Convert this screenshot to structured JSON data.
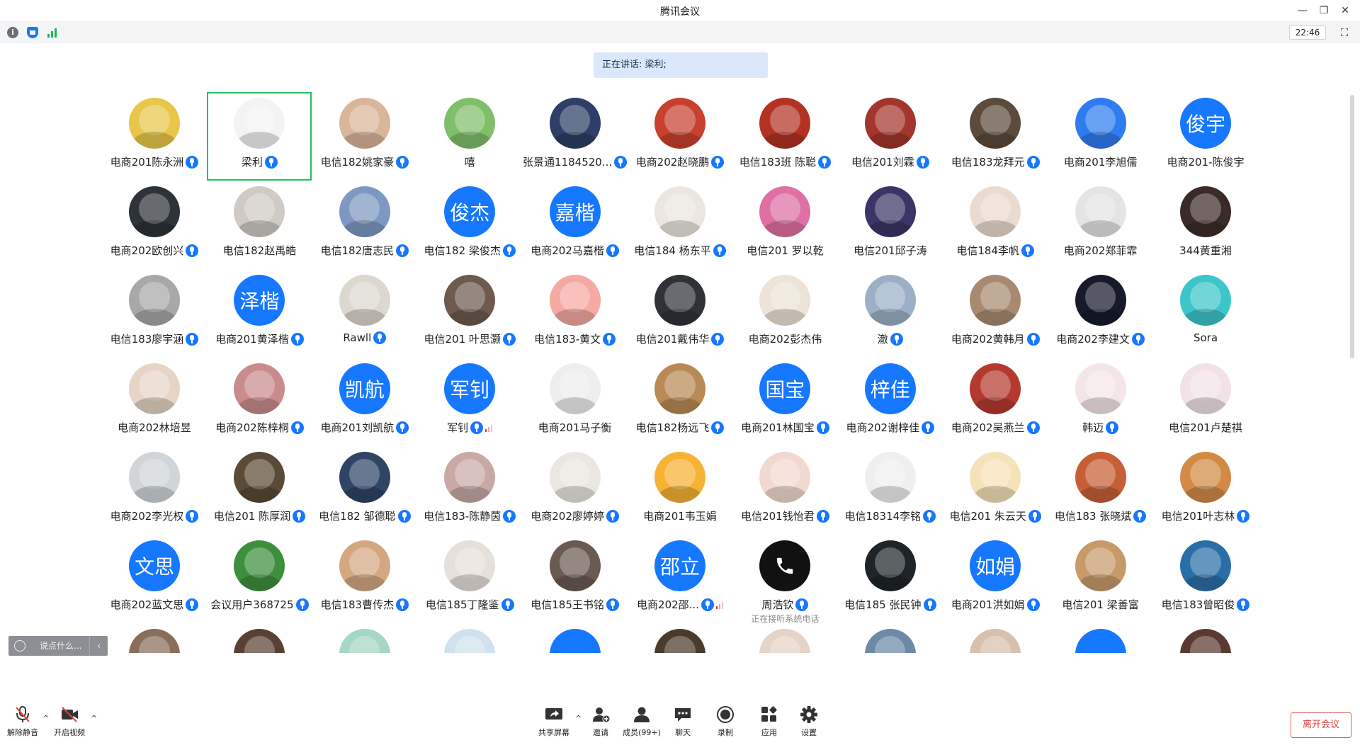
{
  "window": {
    "title": "腾讯会议",
    "minimize": "—",
    "restore": "❐",
    "close": "✕"
  },
  "status": {
    "info_icon": "i",
    "clock": "22:46",
    "fullscreen": "⛶"
  },
  "speaker": "正在讲话: 梁利;",
  "participants": [
    {
      "name": "电商201陈永洲",
      "mic": true,
      "color": "#e8c64a",
      "type": "photo"
    },
    {
      "name": "梁利",
      "mic": true,
      "color": "#f3f3f3",
      "type": "photo",
      "active": true
    },
    {
      "name": "电信182姚家豪",
      "mic": true,
      "color": "#d9b59a",
      "type": "photo"
    },
    {
      "name": "嘻",
      "mic": false,
      "color": "#7fbf6a",
      "type": "photo"
    },
    {
      "name": "张景通1184520...",
      "mic": true,
      "color": "#2d3f66",
      "type": "photo"
    },
    {
      "name": "电商202赵晓鹏",
      "mic": true,
      "color": "#c8412e",
      "type": "photo"
    },
    {
      "name": "电信183班 陈聪",
      "mic": true,
      "color": "#b33323",
      "type": "photo"
    },
    {
      "name": "电信201刘霖",
      "mic": true,
      "color": "#a3352c",
      "type": "photo"
    },
    {
      "name": "电信183龙拜元",
      "mic": true,
      "color": "#5c4a3a",
      "type": "photo"
    },
    {
      "name": "电商201李旭儒",
      "mic": false,
      "color": "#2f7cf0",
      "type": "photo"
    },
    {
      "name": "电商201-陈俊宇",
      "mic": false,
      "color": "#1677ff",
      "type": "text",
      "initials": "俊宇"
    },
    {
      "name": "电商202欧创兴",
      "mic": true,
      "color": "#2d3338",
      "type": "photo"
    },
    {
      "name": "电信182赵禹皓",
      "mic": false,
      "color": "#cfcac4",
      "type": "photo"
    },
    {
      "name": "电信182唐志民",
      "mic": true,
      "color": "#7d99c2",
      "type": "photo"
    },
    {
      "name": "电信182 梁俊杰",
      "mic": true,
      "color": "#1677ff",
      "type": "text",
      "initials": "俊杰"
    },
    {
      "name": "电商202马嘉楷",
      "mic": true,
      "color": "#1677ff",
      "type": "text",
      "initials": "嘉楷"
    },
    {
      "name": "电信184 杨东平",
      "mic": true,
      "color": "#ebe7e0",
      "type": "photo"
    },
    {
      "name": "电信201  罗以乾",
      "mic": false,
      "color": "#e06fa3",
      "type": "photo"
    },
    {
      "name": "电信201邱子涛",
      "mic": false,
      "color": "#3a3566",
      "type": "photo"
    },
    {
      "name": "电信184李帆",
      "mic": true,
      "color": "#eadbd0",
      "type": "photo"
    },
    {
      "name": "电商202郑菲霏",
      "mic": false,
      "color": "#e4e4e4",
      "type": "photo"
    },
    {
      "name": "344黄重湘",
      "mic": false,
      "color": "#3b2b28",
      "type": "photo"
    },
    {
      "name": "电信183廖宇涵",
      "mic": true,
      "color": "#a8a8a8",
      "type": "photo"
    },
    {
      "name": "电商201黄泽楷",
      "mic": true,
      "color": "#1677ff",
      "type": "text",
      "initials": "泽楷"
    },
    {
      "name": "Rawll",
      "mic": true,
      "color": "#ddd8cf",
      "type": "photo"
    },
    {
      "name": "电信201 叶思灏",
      "mic": true,
      "color": "#6e5a4f",
      "type": "photo"
    },
    {
      "name": "电信183-黄文",
      "mic": true,
      "color": "#f4a9a3",
      "type": "photo"
    },
    {
      "name": "电信201戴伟华",
      "mic": true,
      "color": "#2f3338",
      "type": "photo"
    },
    {
      "name": "电商202彭杰伟",
      "mic": false,
      "color": "#ede3d6",
      "type": "photo"
    },
    {
      "name": "澈",
      "mic": true,
      "color": "#9bb0c6",
      "type": "photo"
    },
    {
      "name": "电商202黄韩月",
      "mic": true,
      "color": "#a88a71",
      "type": "photo"
    },
    {
      "name": "电商202李建文",
      "mic": true,
      "color": "#161a2a",
      "type": "photo"
    },
    {
      "name": "Sora",
      "mic": false,
      "color": "#3cc6c9",
      "type": "photo"
    },
    {
      "name": "电商202林培昱",
      "mic": false,
      "color": "#e6d4c5",
      "type": "photo"
    },
    {
      "name": "电商202陈梓桐",
      "mic": true,
      "color": "#c98b8c",
      "type": "photo"
    },
    {
      "name": "电商201刘凯航",
      "mic": true,
      "color": "#1677ff",
      "type": "text",
      "initials": "凯航"
    },
    {
      "name": "军钊",
      "mic": true,
      "vol": true,
      "color": "#1677ff",
      "type": "text",
      "initials": "军钊"
    },
    {
      "name": "电商201马子衡",
      "mic": false,
      "color": "#eeeeee",
      "type": "photo"
    },
    {
      "name": "电信182杨远飞",
      "mic": true,
      "color": "#b98a55",
      "type": "photo"
    },
    {
      "name": "电商201林国宝",
      "mic": true,
      "color": "#1677ff",
      "type": "text",
      "initials": "国宝"
    },
    {
      "name": "电商202谢梓佳",
      "mic": true,
      "color": "#1677ff",
      "type": "text",
      "initials": "梓佳"
    },
    {
      "name": "电商202吴燕兰",
      "mic": true,
      "color": "#b43a2f",
      "type": "photo"
    },
    {
      "name": "韩迈",
      "mic": true,
      "color": "#f4e6e6",
      "type": "photo"
    },
    {
      "name": "电信201卢楚祺",
      "mic": false,
      "color": "#f2e2e8",
      "type": "photo"
    },
    {
      "name": "电商202李光权",
      "mic": true,
      "color": "#cfd5d8",
      "type": "photo"
    },
    {
      "name": "电信201 陈厚润",
      "mic": true,
      "color": "#5b4a35",
      "type": "photo"
    },
    {
      "name": "电信182 邹德聪",
      "mic": true,
      "color": "#2e4566",
      "type": "photo"
    },
    {
      "name": "电信183-陈静茵",
      "mic": true,
      "color": "#c9a9a5",
      "type": "photo"
    },
    {
      "name": "电商202廖婷婷",
      "mic": true,
      "color": "#eae7e1",
      "type": "photo"
    },
    {
      "name": "电商201韦玉娟",
      "mic": false,
      "color": "#f6b233",
      "type": "photo"
    },
    {
      "name": "电信201钱怡君",
      "mic": true,
      "color": "#f1d9cf",
      "type": "photo"
    },
    {
      "name": "电信18314李铭",
      "mic": true,
      "color": "#efefef",
      "type": "photo"
    },
    {
      "name": "电信201 朱云天",
      "mic": true,
      "color": "#f5e2b8",
      "type": "photo"
    },
    {
      "name": "电信183 张晓斌",
      "mic": true,
      "color": "#c65e36",
      "type": "photo"
    },
    {
      "name": "电信201叶志林",
      "mic": true,
      "color": "#d28a45",
      "type": "photo"
    },
    {
      "name": "电商202蓝文思",
      "mic": true,
      "color": "#1677ff",
      "type": "text",
      "initials": "文思"
    },
    {
      "name": "会议用户368725",
      "mic": true,
      "color": "#3c8f3c",
      "type": "photo"
    },
    {
      "name": "电信183曹传杰",
      "mic": true,
      "color": "#d3a881",
      "type": "photo"
    },
    {
      "name": "电信185丁隆鉴",
      "mic": true,
      "color": "#e6e0da",
      "type": "photo"
    },
    {
      "name": "电信185王书铭",
      "mic": true,
      "color": "#6b5a52",
      "type": "photo"
    },
    {
      "name": "电商202邵...",
      "mic": true,
      "vol": true,
      "color": "#1677ff",
      "type": "text",
      "initials": "邵立"
    },
    {
      "name": "周浩钦",
      "mic": true,
      "color": "#111111",
      "type": "phone",
      "note": "正在接听系统电话"
    },
    {
      "name": "电信185 张民钟",
      "mic": true,
      "color": "#1e2428",
      "type": "photo"
    },
    {
      "name": "电商201洪如娟",
      "mic": true,
      "color": "#1677ff",
      "type": "text",
      "initials": "如娟"
    },
    {
      "name": "电信201 梁善富",
      "mic": false,
      "color": "#c79a6a",
      "type": "photo"
    },
    {
      "name": "电信183曾昭俊",
      "mic": true,
      "color": "#2a6ea8",
      "type": "photo"
    },
    {
      "name": "",
      "mic": false,
      "color": "#8a6e5a",
      "type": "photo"
    },
    {
      "name": "",
      "mic": false,
      "color": "#5a4034",
      "type": "photo"
    },
    {
      "name": "",
      "mic": false,
      "color": "#a6d6c4",
      "type": "photo"
    },
    {
      "name": "",
      "mic": false,
      "color": "#cfe2ee",
      "type": "photo"
    },
    {
      "name": "",
      "mic": false,
      "color": "#1677ff",
      "type": "text",
      "initials": ""
    },
    {
      "name": "",
      "mic": false,
      "color": "#4a3a2c",
      "type": "photo"
    },
    {
      "name": "",
      "mic": false,
      "color": "#e4d3c6",
      "type": "photo"
    },
    {
      "name": "",
      "mic": false,
      "color": "#6c8aa6",
      "type": "photo"
    },
    {
      "name": "",
      "mic": false,
      "color": "#d9c0ad",
      "type": "photo"
    },
    {
      "name": "",
      "mic": false,
      "color": "#1677ff",
      "type": "text",
      "initials": ""
    },
    {
      "name": "",
      "mic": false,
      "color": "#5a3a30",
      "type": "photo"
    }
  ],
  "chat": {
    "placeholder": "说点什么...",
    "arrow": "‹"
  },
  "toolbar": {
    "unmute": "解除静音",
    "start_video": "开启视频",
    "share_screen": "共享屏幕",
    "invite": "邀请",
    "members": "成员(99+)",
    "chat": "聊天",
    "record": "录制",
    "apps": "应用",
    "settings": "设置",
    "caret": "^",
    "leave": "离开会议"
  },
  "colors": {
    "accent": "#1677ff",
    "active_border": "#20c25a",
    "leave": "#e03b3b",
    "speaker_bg": "#dbe8fb"
  }
}
